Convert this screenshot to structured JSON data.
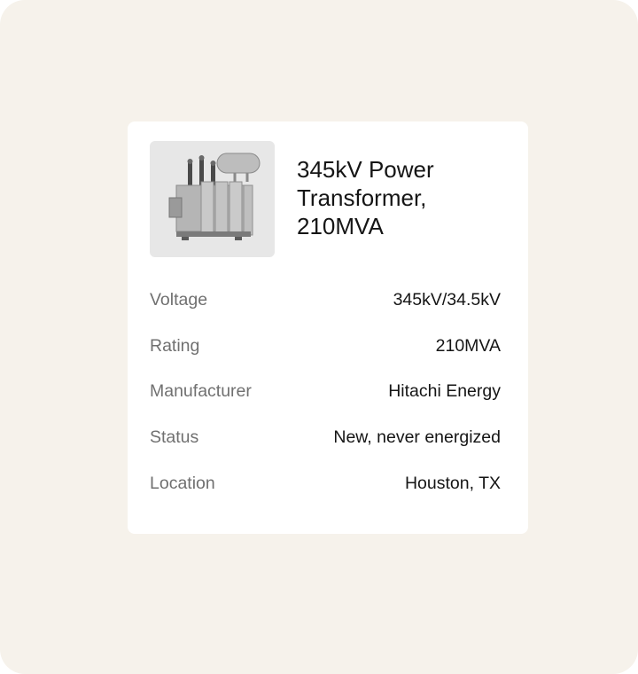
{
  "listing": {
    "title": "345kV Power Transformer, 210MVA",
    "image_icon": "transformer-photo",
    "specs": [
      {
        "label": "Voltage",
        "value": "345kV/34.5kV"
      },
      {
        "label": "Rating",
        "value": "210MVA"
      },
      {
        "label": "Manufacturer",
        "value": "Hitachi Energy"
      },
      {
        "label": "Status",
        "value": "New, never energized"
      },
      {
        "label": "Location",
        "value": "Houston, TX"
      }
    ]
  },
  "colors": {
    "background": "#f6f2eb",
    "card": "#ffffff",
    "label": "#707070",
    "value": "#151515"
  }
}
